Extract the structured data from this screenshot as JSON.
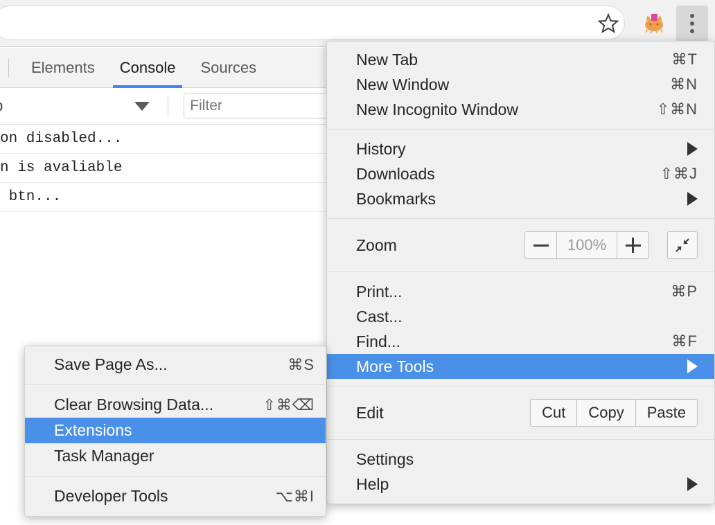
{
  "toolbar": {
    "star_icon": "bookmark-star-icon",
    "extension_icon": "cat-extension-icon",
    "menu_icon": "three-dot-menu-icon"
  },
  "devtools": {
    "tabs": [
      {
        "label": "Elements",
        "active": false
      },
      {
        "label": "Console",
        "active": true
      },
      {
        "label": "Sources",
        "active": false
      }
    ],
    "context_selector": "p",
    "filter_placeholder": "Filter",
    "filter_value": "",
    "console_lines": [
      "on disabled...",
      "n is avaliable",
      " btn..."
    ]
  },
  "menu": {
    "sections": [
      {
        "items": [
          {
            "label": "New Tab",
            "accel": "⌘T",
            "arrow": false,
            "highlight": false
          },
          {
            "label": "New Window",
            "accel": "⌘N",
            "arrow": false,
            "highlight": false
          },
          {
            "label": "New Incognito Window",
            "accel": "⇧⌘N",
            "arrow": false,
            "highlight": false
          }
        ]
      },
      {
        "items": [
          {
            "label": "History",
            "accel": "",
            "arrow": true,
            "highlight": false
          },
          {
            "label": "Downloads",
            "accel": "⇧⌘J",
            "arrow": false,
            "highlight": false
          },
          {
            "label": "Bookmarks",
            "accel": "",
            "arrow": true,
            "highlight": false
          }
        ]
      }
    ],
    "zoom": {
      "label": "Zoom",
      "minus_label": "minus-icon",
      "value": "100%",
      "plus_label": "plus-icon",
      "fullscreen_icon": "exit-fullscreen-icon"
    },
    "sections2": [
      {
        "items": [
          {
            "label": "Print...",
            "accel": "⌘P",
            "arrow": false,
            "highlight": false
          },
          {
            "label": "Cast...",
            "accel": "",
            "arrow": false,
            "highlight": false
          },
          {
            "label": "Find...",
            "accel": "⌘F",
            "arrow": false,
            "highlight": false
          },
          {
            "label": "More Tools",
            "accel": "",
            "arrow": true,
            "highlight": true
          }
        ]
      }
    ],
    "edit": {
      "label": "Edit",
      "buttons": [
        "Cut",
        "Copy",
        "Paste"
      ]
    },
    "sections3": [
      {
        "items": [
          {
            "label": "Settings",
            "accel": "",
            "arrow": false,
            "highlight": false
          },
          {
            "label": "Help",
            "accel": "",
            "arrow": true,
            "highlight": false
          }
        ]
      }
    ]
  },
  "submenu": {
    "groups": [
      {
        "items": [
          {
            "label": "Save Page As...",
            "accel": "⌘S",
            "highlight": false
          }
        ]
      },
      {
        "items": [
          {
            "label": "Clear Browsing Data...",
            "accel": "⇧⌘⌫",
            "highlight": false
          },
          {
            "label": "Extensions",
            "accel": "",
            "highlight": true
          },
          {
            "label": "Task Manager",
            "accel": "",
            "highlight": false
          }
        ]
      },
      {
        "items": [
          {
            "label": "Developer Tools",
            "accel": "⌥⌘I",
            "highlight": false
          }
        ]
      }
    ]
  },
  "colors": {
    "highlight_blue": "#4a90e8",
    "menu_bg": "#f0f0f0",
    "tab_active_underline": "#4285f4"
  }
}
